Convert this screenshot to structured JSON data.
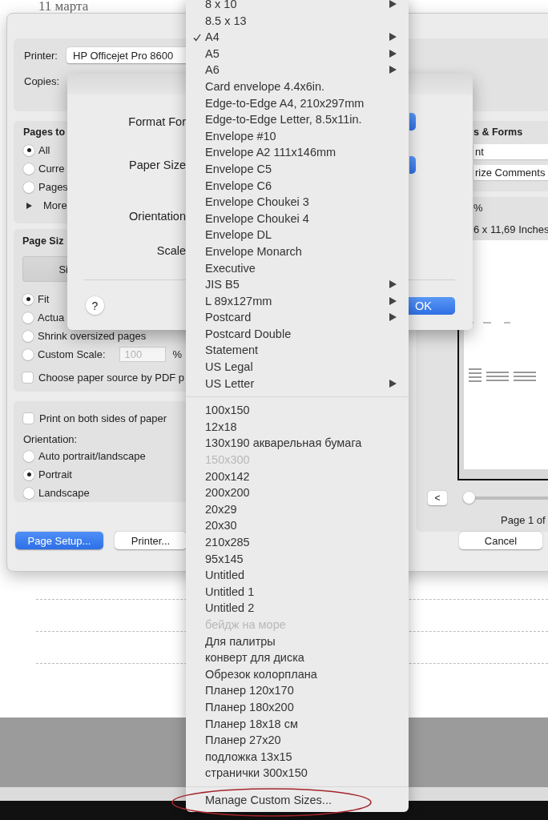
{
  "document": {
    "heading": "11 марта"
  },
  "print_dialog": {
    "printer": {
      "label": "Printer:",
      "value": "HP Officejet Pro 8600"
    },
    "copies": {
      "label": "Copies:"
    },
    "pages_group": {
      "title": "Pages to",
      "options": [
        {
          "label": "All",
          "selected": true
        },
        {
          "label": "Curre",
          "selected": false
        },
        {
          "label": "Pages",
          "selected": false
        }
      ],
      "more": {
        "label": "More",
        "expanded": false
      }
    },
    "page_size_group": {
      "title": "Page Siz",
      "segment": "Si",
      "options": [
        {
          "label": "Fit",
          "selected": true
        },
        {
          "label": "Actua",
          "selected": false
        },
        {
          "label": "Shrink oversized pages",
          "selected": false
        },
        {
          "label": "Custom Scale:",
          "selected": false
        }
      ],
      "custom_scale": {
        "value": "100",
        "disabled": true,
        "unit": "%"
      },
      "paper_source": {
        "label": "Choose paper source by PDF p",
        "checked": false
      }
    },
    "layout_group": {
      "duplex": {
        "label": "Print on both sides of paper",
        "checked": false
      },
      "orientation_label": "Orientation:",
      "orientation_options": [
        {
          "label": "Auto portrait/landscape",
          "selected": false
        },
        {
          "label": "Portrait",
          "selected": true
        },
        {
          "label": "Landscape",
          "selected": false
        }
      ]
    },
    "forms_group": {
      "title": "s & Forms",
      "fields": [
        "nt",
        "rize Comments"
      ]
    },
    "preview": {
      "scale": "%",
      "paper": "6 x 11,69 Inches",
      "prev_button": "<",
      "page_slider": {
        "level": 0
      },
      "page_label": "Page 1 of"
    },
    "left_buttons": [
      {
        "label": "Page Setup...",
        "kind": "default"
      },
      {
        "label": "Printer...",
        "kind": "normal"
      }
    ],
    "cancel_button": {
      "label": "Cancel"
    }
  },
  "page_setup_sheet": {
    "labels": [
      "Format For",
      "Paper Size",
      "Orientation",
      "Scale"
    ],
    "help": "?",
    "ok": "OK"
  },
  "paper_menu": {
    "sections": [
      {
        "items": [
          {
            "label": "8 x 10",
            "checked": false,
            "submenu": true,
            "disabled": false
          },
          {
            "label": "8.5 x 13",
            "checked": false,
            "submenu": false,
            "disabled": false
          },
          {
            "label": "A4",
            "checked": true,
            "submenu": true,
            "disabled": false
          },
          {
            "label": "A5",
            "checked": false,
            "submenu": true,
            "disabled": false
          },
          {
            "label": "A6",
            "checked": false,
            "submenu": true,
            "disabled": false
          },
          {
            "label": "Card envelope 4.4x6in.",
            "checked": false,
            "submenu": false,
            "disabled": false
          },
          {
            "label": "Edge-to-Edge A4, 210x297mm",
            "checked": false,
            "submenu": false,
            "disabled": false
          },
          {
            "label": "Edge-to-Edge Letter, 8.5x11in.",
            "checked": false,
            "submenu": false,
            "disabled": false
          },
          {
            "label": "Envelope #10",
            "checked": false,
            "submenu": false,
            "disabled": false
          },
          {
            "label": "Envelope A2 111x146mm",
            "checked": false,
            "submenu": false,
            "disabled": false
          },
          {
            "label": "Envelope C5",
            "checked": false,
            "submenu": false,
            "disabled": false
          },
          {
            "label": "Envelope C6",
            "checked": false,
            "submenu": false,
            "disabled": false
          },
          {
            "label": "Envelope Choukei 3",
            "checked": false,
            "submenu": false,
            "disabled": false
          },
          {
            "label": "Envelope Choukei 4",
            "checked": false,
            "submenu": false,
            "disabled": false
          },
          {
            "label": "Envelope DL",
            "checked": false,
            "submenu": false,
            "disabled": false
          },
          {
            "label": "Envelope Monarch",
            "checked": false,
            "submenu": false,
            "disabled": false
          },
          {
            "label": "Executive",
            "checked": false,
            "submenu": false,
            "disabled": false
          },
          {
            "label": "JIS B5",
            "checked": false,
            "submenu": true,
            "disabled": false
          },
          {
            "label": "L 89x127mm",
            "checked": false,
            "submenu": true,
            "disabled": false
          },
          {
            "label": "Postcard",
            "checked": false,
            "submenu": true,
            "disabled": false
          },
          {
            "label": "Postcard Double",
            "checked": false,
            "submenu": false,
            "disabled": false
          },
          {
            "label": "Statement",
            "checked": false,
            "submenu": false,
            "disabled": false
          },
          {
            "label": "US Legal",
            "checked": false,
            "submenu": false,
            "disabled": false
          },
          {
            "label": "US Letter",
            "checked": false,
            "submenu": true,
            "disabled": false
          }
        ]
      },
      {
        "items": [
          {
            "label": "100x150",
            "checked": false,
            "submenu": false,
            "disabled": false
          },
          {
            "label": "12x18",
            "checked": false,
            "submenu": false,
            "disabled": false
          },
          {
            "label": "130x190 акварельная бумага",
            "checked": false,
            "submenu": false,
            "disabled": false
          },
          {
            "label": "150x300",
            "checked": false,
            "submenu": false,
            "disabled": true
          },
          {
            "label": "200x142",
            "checked": false,
            "submenu": false,
            "disabled": false
          },
          {
            "label": "200x200",
            "checked": false,
            "submenu": false,
            "disabled": false
          },
          {
            "label": "20x29",
            "checked": false,
            "submenu": false,
            "disabled": false
          },
          {
            "label": "20x30",
            "checked": false,
            "submenu": false,
            "disabled": false
          },
          {
            "label": "210x285",
            "checked": false,
            "submenu": false,
            "disabled": false
          },
          {
            "label": "95x145",
            "checked": false,
            "submenu": false,
            "disabled": false
          },
          {
            "label": "Untitled",
            "checked": false,
            "submenu": false,
            "disabled": false
          },
          {
            "label": "Untitled 1",
            "checked": false,
            "submenu": false,
            "disabled": false
          },
          {
            "label": "Untitled 2",
            "checked": false,
            "submenu": false,
            "disabled": false
          },
          {
            "label": "бейдж на море",
            "checked": false,
            "submenu": false,
            "disabled": true
          },
          {
            "label": "Для палитры",
            "checked": false,
            "submenu": false,
            "disabled": false
          },
          {
            "label": "конверт для диска",
            "checked": false,
            "submenu": false,
            "disabled": false
          },
          {
            "label": "Обрезок колорплана",
            "checked": false,
            "submenu": false,
            "disabled": false
          },
          {
            "label": "Планер 120x170",
            "checked": false,
            "submenu": false,
            "disabled": false
          },
          {
            "label": "Планер 180x200",
            "checked": false,
            "submenu": false,
            "disabled": false
          },
          {
            "label": "Планер 18x18 см",
            "checked": false,
            "submenu": false,
            "disabled": false
          },
          {
            "label": "Планер 27x20",
            "checked": false,
            "submenu": false,
            "disabled": false
          },
          {
            "label": "подложка 13x15",
            "checked": false,
            "submenu": false,
            "disabled": false
          },
          {
            "label": "странички 300x150",
            "checked": false,
            "submenu": false,
            "disabled": false
          }
        ]
      }
    ],
    "footer": "Manage Custom Sizes..."
  }
}
